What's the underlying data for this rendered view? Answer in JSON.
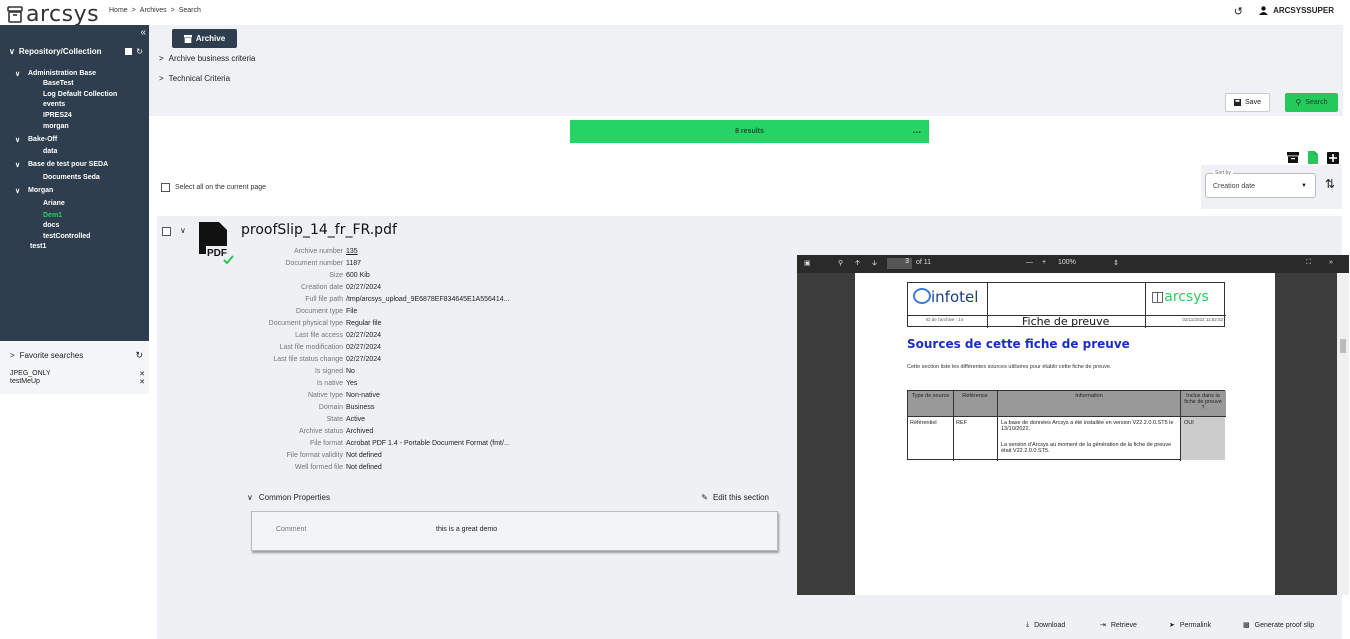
{
  "app": {
    "logo_text": "arcsys"
  },
  "breadcrumb": [
    "Home",
    "Archives",
    "Search"
  ],
  "user": {
    "name": "ARCSYSSUPER"
  },
  "sidebar": {
    "title": "Repository/Collection",
    "tree": [
      {
        "label": "Administration Base",
        "level": 0
      },
      {
        "label": "BaseTest",
        "level": 1
      },
      {
        "label": "Log Default Collection",
        "level": 1
      },
      {
        "label": "events",
        "level": 1
      },
      {
        "label": "IPRES24",
        "level": 1
      },
      {
        "label": "morgan",
        "level": 1
      },
      {
        "label": "Bake-Off",
        "level": 0
      },
      {
        "label": "data",
        "level": 1
      },
      {
        "label": "Base de test pour SEDA",
        "level": 0
      },
      {
        "label": "Documents Seda",
        "level": 1
      },
      {
        "label": "Morgan",
        "level": 0
      },
      {
        "label": "Ariane",
        "level": 1
      },
      {
        "label": "Dem1",
        "level": 1,
        "active": true
      },
      {
        "label": "docs",
        "level": 1
      },
      {
        "label": "testControlled",
        "level": 1
      },
      {
        "label": "test1",
        "level": -1
      }
    ]
  },
  "favorites": {
    "title": "Favorite searches",
    "items": [
      "JPEG_ONLY",
      "testMeUp"
    ]
  },
  "criteria": {
    "archive_button": "Archive",
    "sections": [
      "Archive business criteria",
      "Technical Criteria"
    ],
    "save_label": "Save",
    "search_label": "Search"
  },
  "results": {
    "text": "8 results",
    "more": "..."
  },
  "select_all_label": "Select all on the current page",
  "sort": {
    "label": "Sort by",
    "value": "Creation date"
  },
  "record": {
    "title": "proofSlip_14_fr_FR.pdf",
    "properties": [
      {
        "key": "Archive number",
        "value": "135",
        "link": true
      },
      {
        "key": "Document number",
        "value": "1187"
      },
      {
        "key": "Size",
        "value": "600 Kib"
      },
      {
        "key": "Creation date",
        "value": "02/27/2024"
      },
      {
        "key": "Full file path",
        "value": "/tmp/arcsys_upload_9E6878EF834645E1A556414..."
      },
      {
        "key": "Document type",
        "value": "File"
      },
      {
        "key": "Document physical type",
        "value": "Regular file"
      },
      {
        "key": "Last file access",
        "value": "02/27/2024"
      },
      {
        "key": "Last file modification",
        "value": "02/27/2024"
      },
      {
        "key": "Last file status change",
        "value": "02/27/2024"
      },
      {
        "key": "Is signed",
        "value": "No"
      },
      {
        "key": "Is native",
        "value": "Yes"
      },
      {
        "key": "Native type",
        "value": "Non-native"
      },
      {
        "key": "Domain",
        "value": "Business"
      },
      {
        "key": "State",
        "value": "Active"
      },
      {
        "key": "Archive status",
        "value": "Archived"
      },
      {
        "key": "File format",
        "value": "Acrobat PDF 1.4 - Portable Document Format (fmt/..."
      },
      {
        "key": "File format validity",
        "value": "Not defined"
      },
      {
        "key": "Well formed file",
        "value": "Not defined"
      }
    ],
    "common_title": "Common Properties",
    "edit_label": "Edit this section",
    "comment_key": "Comment",
    "comment_value": "this is a great demo"
  },
  "viewer": {
    "page_current": "3",
    "page_total": "of 11",
    "zoom": "100%",
    "pdf": {
      "logo_left": "infotel",
      "archive_id": "ID de l'archive : 14",
      "doc_title": "Fiche de preuve",
      "logo_right": "arcsys",
      "doc_date": "02/11/2022 11:52:52",
      "heading": "Sources de cette fiche de preuve",
      "intro": "Cette section liste les différentes sources utilisées pour établir cette fiche de preuve.",
      "table_headers": [
        "Type de source",
        "Référence",
        "Information",
        "Inclus dans la fiche de preuve ?"
      ],
      "row": {
        "type": "Référentiel",
        "ref": "REF",
        "info1": "La base de données Arcsys a été installée en version V22.2.0.0.ST5 le 13/10/2022.",
        "info2": "La version d'Arcsys au moment de la génération de la fiche de preuve était V22.2.0.0.ST5.",
        "included": "OUI"
      }
    }
  },
  "actions": [
    "Download",
    "Retrieve",
    "Permalink",
    "Generate proof slip"
  ],
  "colors": {
    "accent": "#25d366",
    "sidebar": "#2f3e4f"
  }
}
